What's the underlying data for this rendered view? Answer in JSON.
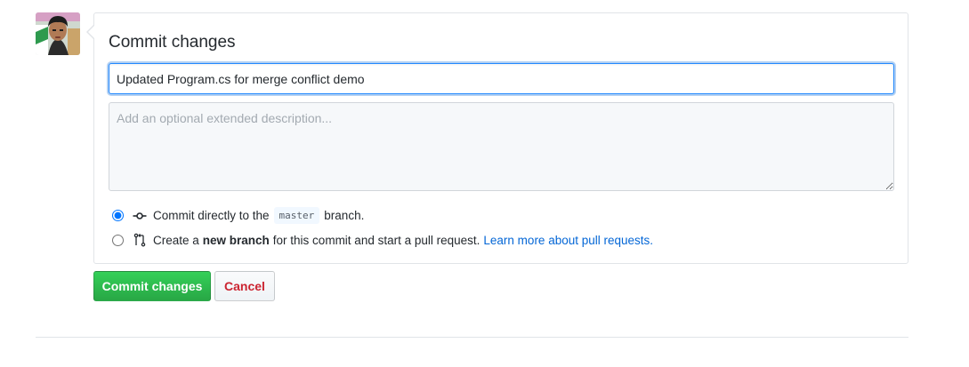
{
  "commit_form": {
    "title": "Commit changes",
    "summary_value": "Updated Program.cs for merge conflict demo",
    "description_placeholder": "Add an optional extended description...",
    "options": {
      "direct": {
        "prefix": "Commit directly to the",
        "branch": "master",
        "suffix": "branch.",
        "selected": true,
        "icon": "git-commit-icon"
      },
      "new_branch": {
        "prefix": "Create a",
        "bold": "new branch",
        "suffix": "for this commit and start a pull request.",
        "link": "Learn more about pull requests.",
        "selected": false,
        "icon": "git-pull-request-icon"
      }
    }
  },
  "actions": {
    "commit_label": "Commit changes",
    "cancel_label": "Cancel"
  },
  "colors": {
    "primary": "#28a745",
    "danger": "#cb2431",
    "link": "#0366d6"
  }
}
